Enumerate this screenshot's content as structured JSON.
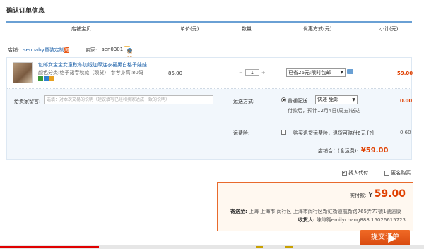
{
  "page": {
    "title": "确认订单信息"
  },
  "table_headers": [
    "店铺宝贝",
    "单价(元)",
    "数量",
    "优惠方式(元)",
    "小计(元)"
  ],
  "shop": {
    "label": "店铺:",
    "name": "senbaby童装定制",
    "seller_label": "卖家:",
    "seller": "sen0301",
    "contact": "和我联系"
  },
  "item": {
    "name": "包邮女宝宝女童秋冬加绒加厚连衣裙黑白格子娃娃...",
    "sku": "颜色分类:格子裙春秋款（现货）  参考身高:80码",
    "price": "85.00",
    "quantity": "1",
    "promo": "已省26元:限时包邮",
    "subtotal": "59.00"
  },
  "message": {
    "label": "给卖家留言:",
    "placeholder": "选填：对本次交易的说明（建议填写已经和卖家达成一致的说明）"
  },
  "shipping": {
    "label": "运送方式:",
    "option": "普通配送",
    "select": "快递 免邮",
    "fee": "0.00",
    "note": "付款后，预计12月4日(周五)送达"
  },
  "insurance": {
    "label": "运费险:",
    "text": "购买退货运费险，退货可赔付6元",
    "help": "[?]",
    "fee": "0.60"
  },
  "shop_total": {
    "label": "店铺合计(含运费):",
    "amount": "¥59.00"
  },
  "options": {
    "agent_pay": "找人代付",
    "anonymous": "匿名购买",
    "agent_checked": true,
    "anonymous_checked": false
  },
  "payment": {
    "real_label": "实付款:",
    "currency": "¥",
    "amount": "59.00",
    "address_label": "寄送至:",
    "address": "上海 上海市 闵行区 上海市闵行区新虹街道航新路765弄77號1號遠康",
    "receiver_label": "收货人:",
    "receiver": "陳琲翱emilychang888 15026615723"
  },
  "submit_label": "提交订单",
  "colors": {
    "accent": "#e86a2c",
    "price": "#e04000",
    "link": "#1a5fa8",
    "header_line": "#6aa0d4"
  }
}
